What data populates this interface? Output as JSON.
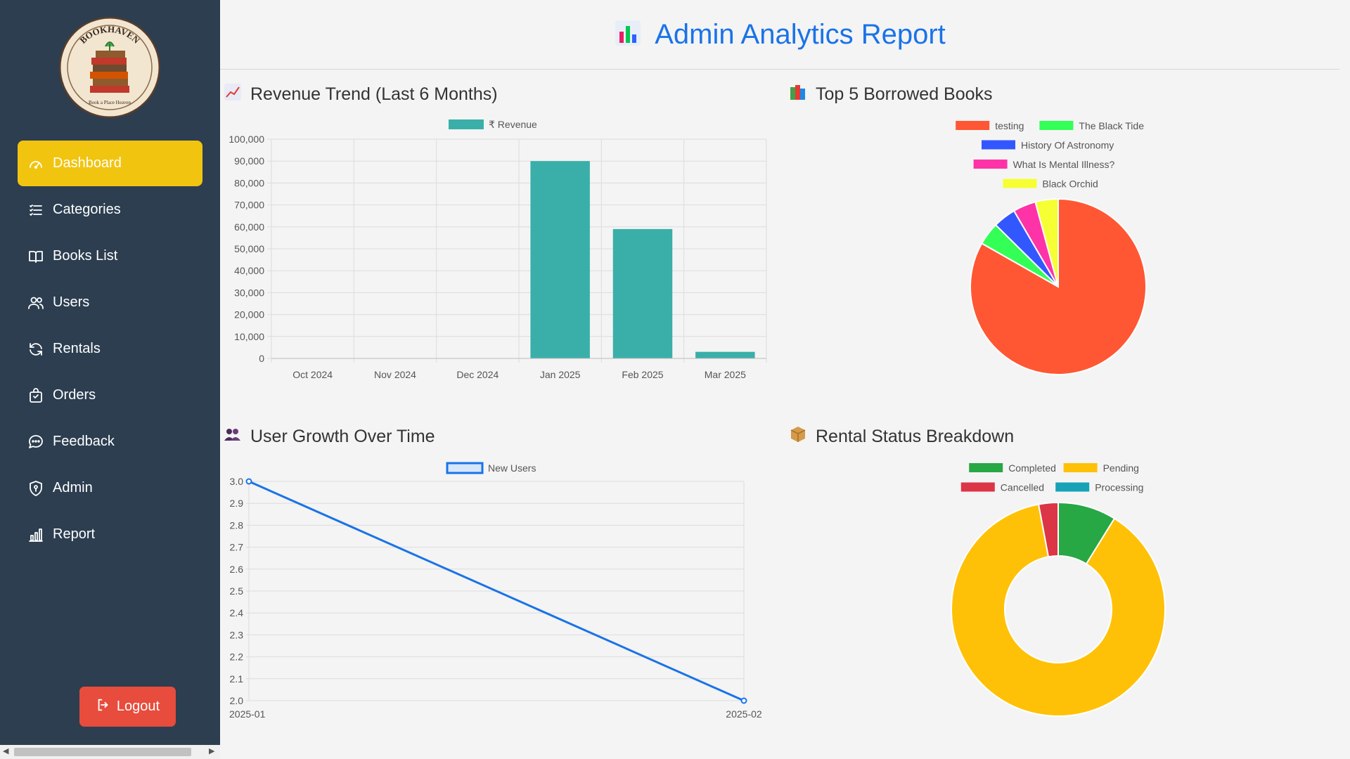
{
  "sidebar": {
    "logo_text": "BOOKHAVEN",
    "logo_subtext": "Book a Place Heaven",
    "items": [
      {
        "label": "Dashboard",
        "icon": "gauge-icon",
        "active": true
      },
      {
        "label": "Categories",
        "icon": "list-icon",
        "active": false
      },
      {
        "label": "Books List",
        "icon": "book-open-icon",
        "active": false
      },
      {
        "label": "Users",
        "icon": "users-icon",
        "active": false
      },
      {
        "label": "Rentals",
        "icon": "refresh-icon",
        "active": false
      },
      {
        "label": "Orders",
        "icon": "shopping-bag-icon",
        "active": false
      },
      {
        "label": "Feedback",
        "icon": "chat-icon",
        "active": false
      },
      {
        "label": "Admin",
        "icon": "shield-icon",
        "active": false
      },
      {
        "label": "Report",
        "icon": "bar-chart-icon",
        "active": false
      }
    ],
    "logout_label": "Logout"
  },
  "header": {
    "title": "Admin Analytics Report"
  },
  "panels": {
    "revenue": {
      "title": "Revenue Trend (Last 6 Months)"
    },
    "borrowed": {
      "title": "Top 5 Borrowed Books"
    },
    "users": {
      "title": "User Growth Over Time"
    },
    "rental": {
      "title": "Rental Status Breakdown"
    }
  },
  "colors": {
    "sidebar_bg": "#2c3e50",
    "active_item": "#f1c40f",
    "logout": "#e74c3c",
    "title_blue": "#1a73e8",
    "revenue_bar": "#3aafa9"
  },
  "chart_data": [
    {
      "id": "revenue",
      "type": "bar",
      "categories": [
        "Oct 2024",
        "Nov 2024",
        "Dec 2024",
        "Jan 2025",
        "Feb 2025",
        "Mar 2025"
      ],
      "series": [
        {
          "name": "₹ Revenue",
          "values": [
            0,
            0,
            0,
            90000,
            59000,
            3000
          ],
          "color": "#3aafa9"
        }
      ],
      "ylim": [
        0,
        100000
      ],
      "yticks": [
        "0",
        "10,000",
        "20,000",
        "30,000",
        "40,000",
        "50,000",
        "60,000",
        "70,000",
        "80,000",
        "90,000",
        "100,000"
      ],
      "grid": true,
      "legend": "top-center"
    },
    {
      "id": "borrowed",
      "type": "pie",
      "labels": [
        "testing",
        "The Black Tide",
        "History Of Astronomy",
        "What Is Mental Illness?",
        "Black Orchid"
      ],
      "values": [
        83.3,
        4.2,
        4.2,
        4.2,
        4.2
      ],
      "colors": [
        "#ff5733",
        "#33ff57",
        "#3357ff",
        "#ff33a8",
        "#f5ff33"
      ],
      "legend": "top-center"
    },
    {
      "id": "users",
      "type": "line",
      "x": [
        "2025-01",
        "2025-02"
      ],
      "series": [
        {
          "name": "New Users",
          "values": [
            3,
            2
          ],
          "color": "#1a73e8"
        }
      ],
      "ylim": [
        2.0,
        3.0
      ],
      "yticks": [
        "2.0",
        "2.1",
        "2.2",
        "2.3",
        "2.4",
        "2.5",
        "2.6",
        "2.7",
        "2.8",
        "2.9",
        "3.0"
      ],
      "grid": true,
      "legend": "top-center"
    },
    {
      "id": "rental",
      "type": "pie",
      "subtype": "doughnut",
      "labels": [
        "Completed",
        "Pending",
        "Cancelled",
        "Processing"
      ],
      "values": [
        3,
        30,
        1,
        0
      ],
      "colors": [
        "#28a745",
        "#ffc107",
        "#dc3545",
        "#17a2b8"
      ],
      "legend": "top-center"
    }
  ]
}
